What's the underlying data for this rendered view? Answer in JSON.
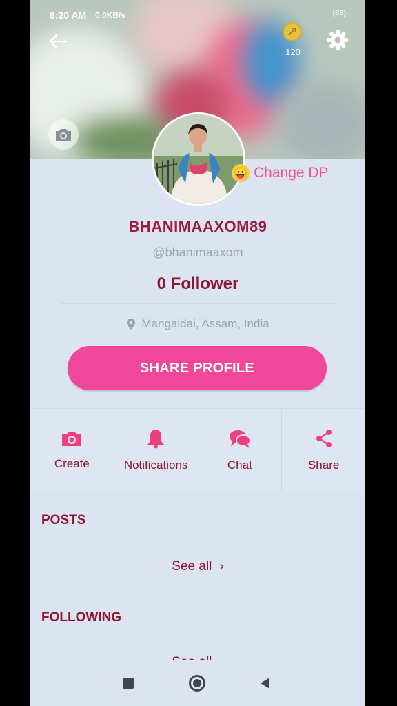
{
  "status_bar": {
    "time": "6:20 AM",
    "speed": "0.0KB/s",
    "battery": "(89)"
  },
  "cover": {
    "coins": "120"
  },
  "profile": {
    "change_dp_label": "Change DP",
    "username": "BHANIMAAXOM89",
    "handle": "@bhanimaaxom",
    "followers": "0 Follower",
    "location": "Mangaldai, Assam, India"
  },
  "share_profile_label": "SHARE PROFILE",
  "actions": [
    {
      "label": "Create",
      "icon": "camera-icon"
    },
    {
      "label": "Notifications",
      "icon": "bell-icon"
    },
    {
      "label": "Chat",
      "icon": "chat-icon"
    },
    {
      "label": "Share",
      "icon": "share-icon"
    }
  ],
  "sections": {
    "posts_title": "POSTS",
    "posts_see_all": "See all",
    "following_title": "FOLLOWING",
    "following_see_all": "See all"
  },
  "colors": {
    "accent": "#f0479a",
    "primary_text": "#8e1533",
    "background": "#dbe4f0"
  }
}
